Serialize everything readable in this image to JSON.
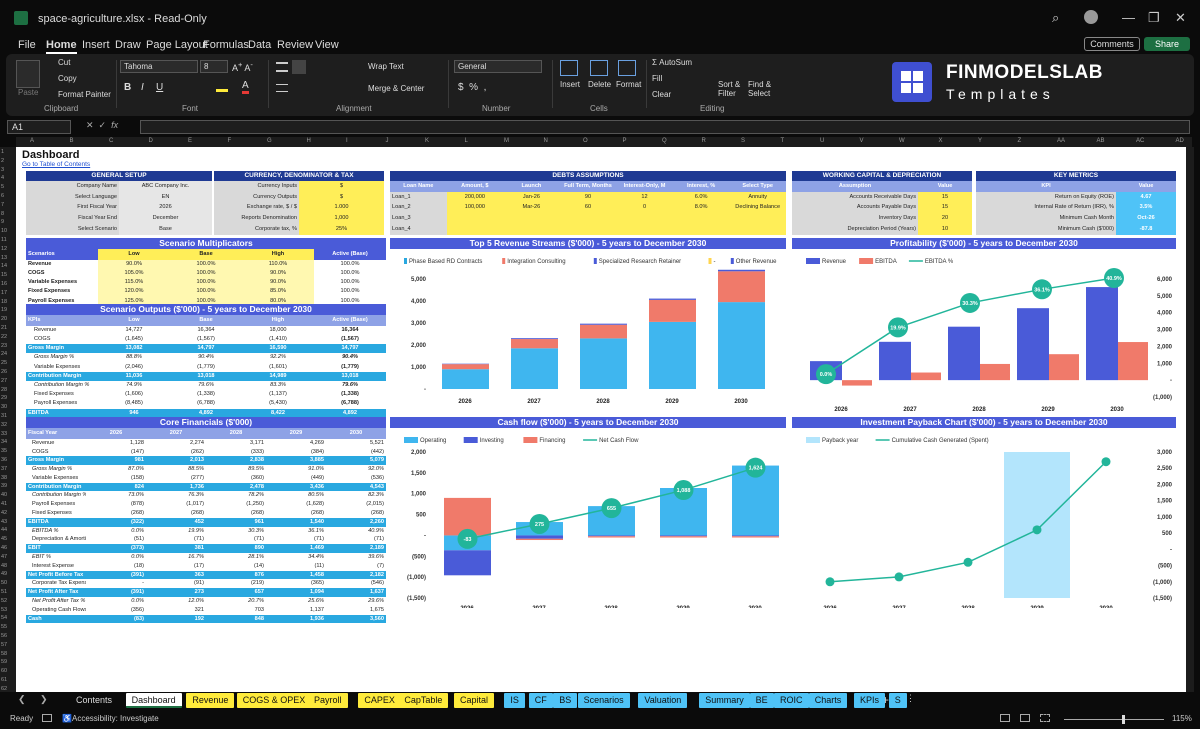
{
  "window": {
    "title": "space-agriculture.xlsx  -  Read-Only"
  },
  "menu": [
    "File",
    "Home",
    "Insert",
    "Draw",
    "Page Layout",
    "Formulas",
    "Data",
    "Review",
    "View"
  ],
  "menu_active": "Home",
  "buttons": {
    "comments": "Comments",
    "share": "Share"
  },
  "ribbon": {
    "paste": "Paste",
    "cut": "Cut",
    "copy": "Copy",
    "format_painter": "Format Painter",
    "clipboard": "Clipboard",
    "font_name": "Tahoma",
    "font_size": "8",
    "font": "Font",
    "wrap": "Wrap Text",
    "merge": "Merge & Center",
    "alignment": "Alignment",
    "number_format": "General",
    "number": "Number",
    "insert": "Insert",
    "delete": "Delete",
    "format": "Format",
    "cells": "Cells",
    "autosum": "AutoSum",
    "fill": "Fill",
    "clear": "Clear",
    "sort": "Sort &",
    "filter": "Filter",
    "find": "Find &",
    "select": "Select",
    "editing": "Editing",
    "logo_name": "FINMODELSLAB",
    "logo_sub": "Templates"
  },
  "namebox": "A1",
  "columns": [
    "A",
    "B",
    "C",
    "D",
    "E",
    "F",
    "G",
    "H",
    "I",
    "J",
    "K",
    "L",
    "M",
    "N",
    "O",
    "P",
    "Q",
    "R",
    "S",
    "T",
    "U",
    "V",
    "W",
    "X",
    "Y",
    "Z",
    "AA",
    "AB",
    "AC",
    "AD"
  ],
  "dashboard": {
    "title": "Dashboard",
    "toc": "Go to Table of Contents",
    "general": {
      "header": "GENERAL SETUP",
      "rows": [
        [
          "Company Name",
          "ABC Company Inc."
        ],
        [
          "Select Language",
          "EN"
        ],
        [
          "First Fiscal Year",
          "2026"
        ],
        [
          "Fiscal Year End",
          "December"
        ],
        [
          "Select Scenario",
          "Base"
        ]
      ]
    },
    "currency": {
      "header": "CURRENCY, DENOMINATOR & TAX",
      "rows": [
        [
          "Currency Inputs",
          "$"
        ],
        [
          "Currency Outputs",
          "$"
        ],
        [
          "Exchange rate, $ / $",
          "1.000"
        ],
        [
          "Reports Denomination",
          "1,000"
        ],
        [
          "Corporate tax, %",
          "25%"
        ]
      ]
    },
    "debts": {
      "header": "DEBTS ASSUMPTIONS",
      "cols": [
        "Loan Name",
        "Amount, $",
        "Launch",
        "Full Term, Months",
        "Interest-Only, M",
        "Interest, %",
        "Select Type"
      ],
      "rows": [
        [
          "Loan_1",
          "200,000",
          "Jan-26",
          "90",
          "12",
          "6.0%",
          "Annuity"
        ],
        [
          "Loan_2",
          "100,000",
          "Mar-26",
          "60",
          "0",
          "8.0%",
          "Declining Balance"
        ],
        [
          "Loan_3",
          "",
          "",
          "",
          "",
          "",
          ""
        ],
        [
          "Loan_4",
          "",
          "",
          "",
          "",
          "",
          ""
        ]
      ]
    },
    "wc": {
      "header": "WORKING CAPITAL & DEPRECIATION",
      "cols": [
        "Assumption",
        "Value"
      ],
      "rows": [
        [
          "Accounts Receivable Days",
          "15"
        ],
        [
          "Accounts Payable Days",
          "15"
        ],
        [
          "Inventory Days",
          "20"
        ],
        [
          "Depreciation Period (Years)",
          "10"
        ]
      ]
    },
    "kpi": {
      "header": "KEY METRICS",
      "cols": [
        "KPI",
        "Value"
      ],
      "rows": [
        [
          "Return on Equity (ROE)",
          "4.67"
        ],
        [
          "Internal Rate of Return (IRR), %",
          "3.5%"
        ],
        [
          "Minimum Cash Month",
          "Oct-26"
        ],
        [
          "Minimum Cash ($'000)",
          "-87.8"
        ]
      ]
    },
    "multipliers": {
      "header": "Scenario Multiplicators",
      "cols": [
        "Scenarios",
        "Low",
        "Base",
        "High",
        "Active (Base)"
      ],
      "rows": [
        [
          "Revenue",
          "90.0%",
          "100.0%",
          "110.0%",
          "100.0%"
        ],
        [
          "COGS",
          "105.0%",
          "100.0%",
          "90.0%",
          "100.0%"
        ],
        [
          "Variable Expenses",
          "115.0%",
          "100.0%",
          "90.0%",
          "100.0%"
        ],
        [
          "Fixed Expenses",
          "120.0%",
          "100.0%",
          "85.0%",
          "100.0%"
        ],
        [
          "Payroll Expenses",
          "125.0%",
          "100.0%",
          "80.0%",
          "100.0%"
        ]
      ]
    },
    "outputs": {
      "header": "Scenario Outputs ($'000) - 5 years to December 2030",
      "cols": [
        "KPIs",
        "Low",
        "Base",
        "High",
        "Active (Base)"
      ],
      "rows": [
        {
          "k": "Revenue",
          "v": [
            "14,727",
            "16,364",
            "18,000",
            "16,364"
          ],
          "s": "n"
        },
        {
          "k": "COGS",
          "v": [
            "(1,645)",
            "(1,567)",
            "(1,410)",
            "(1,567)"
          ],
          "s": "n"
        },
        {
          "k": "Gross Margin",
          "v": [
            "13,082",
            "14,797",
            "16,590",
            "14,797"
          ],
          "s": "hi"
        },
        {
          "k": "Gross Margin %",
          "v": [
            "88.8%",
            "90.4%",
            "92.2%",
            "90.4%"
          ],
          "s": "it"
        },
        {
          "k": "Variable Expenses",
          "v": [
            "(2,046)",
            "(1,779)",
            "(1,601)",
            "(1,779)"
          ],
          "s": "n"
        },
        {
          "k": "Contribution Margin",
          "v": [
            "11,036",
            "13,018",
            "14,989",
            "13,018"
          ],
          "s": "hi"
        },
        {
          "k": "Contribution Margin %",
          "v": [
            "74.9%",
            "79.6%",
            "83.3%",
            "79.6%"
          ],
          "s": "it"
        },
        {
          "k": "Fixed Expenses",
          "v": [
            "(1,606)",
            "(1,338)",
            "(1,137)",
            "(1,338)"
          ],
          "s": "n"
        },
        {
          "k": "Payroll Expenses",
          "v": [
            "(8,485)",
            "(6,788)",
            "(5,430)",
            "(6,788)"
          ],
          "s": "n"
        },
        {
          "k": "EBITDA",
          "v": [
            "946",
            "4,892",
            "8,422",
            "4,892"
          ],
          "s": "hi"
        },
        {
          "k": "EBITDA %",
          "v": [
            "6.4%",
            "29.9%",
            "46.8%",
            "29.9%"
          ],
          "s": "it"
        }
      ]
    },
    "core": {
      "header": "Core Financials ($'000)",
      "cols": [
        "Fiscal Year",
        "2026",
        "2027",
        "2028",
        "2029",
        "2030"
      ],
      "rows": [
        {
          "k": "Revenue",
          "v": [
            "1,128",
            "2,274",
            "3,171",
            "4,269",
            "5,521"
          ],
          "s": "n"
        },
        {
          "k": "COGS",
          "v": [
            "(147)",
            "(262)",
            "(333)",
            "(384)",
            "(442)"
          ],
          "s": "n"
        },
        {
          "k": "Gross Margin",
          "v": [
            "981",
            "2,013",
            "2,838",
            "3,885",
            "5,079"
          ],
          "s": "hi"
        },
        {
          "k": "Gross Margin %",
          "v": [
            "87.0%",
            "88.5%",
            "89.5%",
            "91.0%",
            "92.0%"
          ],
          "s": "it"
        },
        {
          "k": "Variable Expenses",
          "v": [
            "(158)",
            "(277)",
            "(360)",
            "(449)",
            "(536)"
          ],
          "s": "n"
        },
        {
          "k": "Contribution Margin",
          "v": [
            "824",
            "1,736",
            "2,478",
            "3,436",
            "4,543"
          ],
          "s": "hi"
        },
        {
          "k": "Contribution Margin %",
          "v": [
            "73.0%",
            "76.3%",
            "78.2%",
            "80.5%",
            "82.3%"
          ],
          "s": "it"
        },
        {
          "k": "Payroll Expenses",
          "v": [
            "(878)",
            "(1,017)",
            "(1,250)",
            "(1,628)",
            "(2,015)"
          ],
          "s": "n"
        },
        {
          "k": "Fixed Expenses",
          "v": [
            "(268)",
            "(268)",
            "(268)",
            "(268)",
            "(268)"
          ],
          "s": "n"
        },
        {
          "k": "EBITDA",
          "v": [
            "(322)",
            "452",
            "961",
            "1,540",
            "2,260"
          ],
          "s": "hi"
        },
        {
          "k": "EBITDA %",
          "v": [
            "0.0%",
            "19.9%",
            "30.3%",
            "36.1%",
            "40.9%"
          ],
          "s": "it"
        },
        {
          "k": "Depreciation & Amortization",
          "v": [
            "(51)",
            "(71)",
            "(71)",
            "(71)",
            "(71)"
          ],
          "s": "n"
        },
        {
          "k": "EBIT",
          "v": [
            "(373)",
            "381",
            "890",
            "1,469",
            "2,189"
          ],
          "s": "hi"
        },
        {
          "k": "EBIT %",
          "v": [
            "0.0%",
            "16.7%",
            "28.1%",
            "34.4%",
            "39.6%"
          ],
          "s": "it"
        },
        {
          "k": "Interest Expense",
          "v": [
            "(18)",
            "(17)",
            "(14)",
            "(11)",
            "(7)"
          ],
          "s": "n"
        },
        {
          "k": "Net Profit Before Tax",
          "v": [
            "(391)",
            "363",
            "876",
            "1,458",
            "2,182"
          ],
          "s": "hi"
        },
        {
          "k": "Corporate Tax Expense",
          "v": [
            "-",
            "(91)",
            "(219)",
            "(365)",
            "(546)"
          ],
          "s": "n"
        },
        {
          "k": "Net Profit After Tax",
          "v": [
            "(391)",
            "273",
            "657",
            "1,094",
            "1,637"
          ],
          "s": "hi"
        },
        {
          "k": "Net Profit After Tax %",
          "v": [
            "0.0%",
            "12.0%",
            "20.7%",
            "25.6%",
            "29.6%"
          ],
          "s": "it"
        },
        {
          "k": "Operating Cash Flows",
          "v": [
            "(356)",
            "321",
            "703",
            "1,137",
            "1,675"
          ],
          "s": "n"
        },
        {
          "k": "Cash",
          "v": [
            "(83)",
            "192",
            "848",
            "1,936",
            "3,560"
          ],
          "s": "hi"
        }
      ]
    }
  },
  "chart_data": [
    {
      "type": "bar",
      "title": "Top 5 Revenue Streams ($'000) - 5 years to December 2030",
      "categories": [
        "2026",
        "2027",
        "2028",
        "2029",
        "2030"
      ],
      "series": [
        {
          "name": "Phase Based RD Contracts",
          "values": [
            900,
            1850,
            2300,
            3050,
            3950
          ]
        },
        {
          "name": "Integration Consulting",
          "values": [
            230,
            420,
            620,
            1000,
            1400
          ]
        },
        {
          "name": "Specialized Research Retainer",
          "values": [
            20,
            40,
            50,
            60,
            70
          ]
        },
        {
          "name": "-",
          "values": [
            0,
            0,
            0,
            0,
            0
          ]
        },
        {
          "name": "Other Revenue",
          "values": [
            0,
            0,
            0,
            0,
            0
          ]
        }
      ],
      "ylim": [
        0,
        5000
      ],
      "yticks": [
        "-",
        "1,000",
        "2,000",
        "3,000",
        "4,000",
        "5,000"
      ]
    },
    {
      "type": "bar",
      "title": "Profitability ($'000) - 5 years to December 2030",
      "categories": [
        "2026",
        "2027",
        "2028",
        "2029",
        "2030"
      ],
      "series": [
        {
          "name": "Revenue",
          "values": [
            1128,
            2274,
            3171,
            4269,
            5521
          ]
        },
        {
          "name": "EBITDA",
          "values": [
            -322,
            452,
            961,
            1540,
            2260
          ]
        },
        {
          "name": "EBITDA %",
          "values": [
            0.0,
            19.9,
            30.3,
            36.1,
            40.9
          ]
        }
      ],
      "labels": [
        "0.0%",
        "19.9%",
        "30.3%",
        "36.1%",
        "40.9%"
      ],
      "ylim": [
        -1000,
        6000
      ],
      "yticks": [
        "(1,000)",
        "-",
        "1,000",
        "2,000",
        "3,000",
        "4,000",
        "5,000",
        "6,000"
      ]
    },
    {
      "type": "bar",
      "title": "Cash flow ($'000) - 5 years to December 2030",
      "categories": [
        "2026",
        "2027",
        "2028",
        "2029",
        "2030"
      ],
      "series": [
        {
          "name": "Operating",
          "values": [
            -356,
            321,
            703,
            1137,
            1675
          ]
        },
        {
          "name": "Investing",
          "values": [
            -600,
            -80,
            -20,
            -20,
            -20
          ]
        },
        {
          "name": "Financing",
          "values": [
            900,
            -30,
            -30,
            -30,
            -30
          ]
        },
        {
          "name": "Net Cash Flow",
          "values": [
            -83,
            275,
            655,
            1088,
            1624
          ]
        }
      ],
      "labels": [
        "-83",
        "275",
        "655",
        "1,088",
        "1,624"
      ],
      "ylim": [
        -1500,
        2000
      ],
      "yticks": [
        "(1,500)",
        "(1,000)",
        "(500)",
        "-",
        "500",
        "1,000",
        "1,500",
        "2,000"
      ]
    },
    {
      "type": "line",
      "title": "Investment Payback Chart ($'000) - 5 years to December 2030",
      "categories": [
        "2026",
        "2027",
        "2028",
        "2029",
        "2030"
      ],
      "series": [
        {
          "name": "Payback year",
          "values": [
            0,
            0,
            0,
            1,
            0
          ]
        },
        {
          "name": "Cumulative Cash Generated (Spent)",
          "values": [
            -1000,
            -850,
            -400,
            600,
            2700
          ]
        }
      ],
      "ylim": [
        -1500,
        3000
      ],
      "yticks": [
        "(1,500)",
        "(1,000)",
        "(500)",
        "-",
        "500",
        "1,000",
        "1,500",
        "2,000",
        "2,500",
        "3,000"
      ]
    }
  ],
  "sheet_tabs": [
    {
      "label": "Contents",
      "color": "#0b0b0b",
      "fg": "#ddd"
    },
    {
      "label": "Dashboard",
      "color": "#ffffff",
      "fg": "#111"
    },
    {
      "label": "Revenue",
      "color": "#ffeb3b",
      "fg": "#111"
    },
    {
      "label": "COGS & OPEX",
      "color": "#ffeb3b",
      "fg": "#111"
    },
    {
      "label": "Payroll",
      "color": "#ffeb3b",
      "fg": "#111"
    },
    {
      "label": "CAPEX",
      "color": "#ffeb3b",
      "fg": "#111"
    },
    {
      "label": "CapTable",
      "color": "#ffeb3b",
      "fg": "#111"
    },
    {
      "label": "Capital",
      "color": "#ffeb3b",
      "fg": "#111"
    },
    {
      "label": "IS",
      "color": "#4fc3f7",
      "fg": "#111"
    },
    {
      "label": "CF",
      "color": "#4fc3f7",
      "fg": "#111"
    },
    {
      "label": "BS",
      "color": "#4fc3f7",
      "fg": "#111"
    },
    {
      "label": "Scenarios",
      "color": "#4fc3f7",
      "fg": "#111"
    },
    {
      "label": "Valuation",
      "color": "#4fc3f7",
      "fg": "#111"
    },
    {
      "label": "Summary",
      "color": "#4fc3f7",
      "fg": "#111"
    },
    {
      "label": "BE",
      "color": "#4fc3f7",
      "fg": "#111"
    },
    {
      "label": "ROIC",
      "color": "#4fc3f7",
      "fg": "#111"
    },
    {
      "label": "Charts",
      "color": "#4fc3f7",
      "fg": "#111"
    },
    {
      "label": "KPIs",
      "color": "#4fc3f7",
      "fg": "#111"
    },
    {
      "label": "S",
      "color": "#4fc3f7",
      "fg": "#111"
    }
  ],
  "status": {
    "ready": "Ready",
    "accessibility": "Accessibility: Investigate",
    "zoom": "115%"
  },
  "colors": {
    "navy": "#1f3a93",
    "blue": "#4a5bd8",
    "cyan": "#29a8e0",
    "sky": "#3fb6ef",
    "salmon": "#f07a6a",
    "teal": "#22b59a",
    "yellow": "#ffee58"
  }
}
